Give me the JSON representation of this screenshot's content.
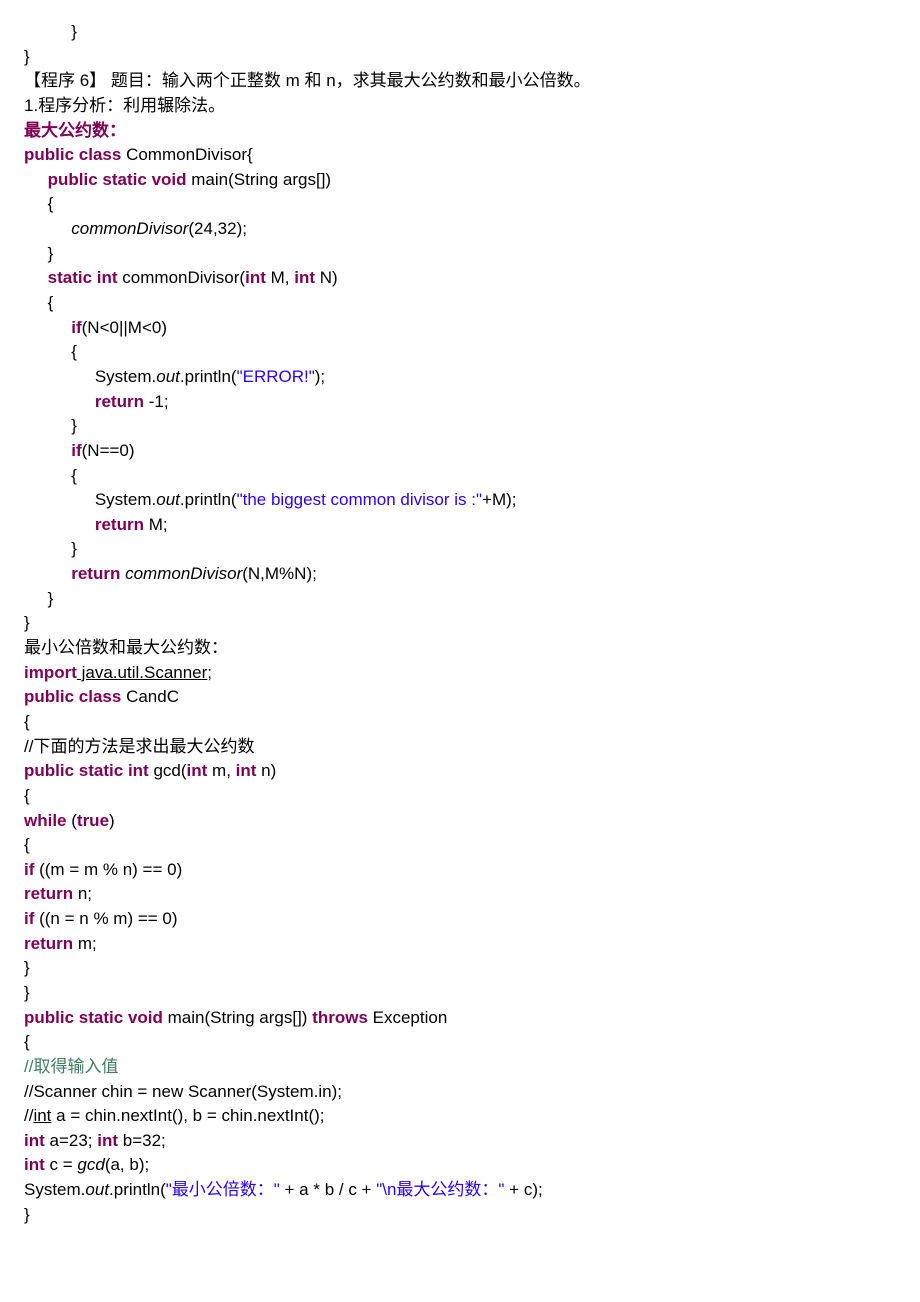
{
  "closing1": "          }",
  "closing2": "}",
  "progTitle": "【程序 6】  题目：输入两个正整数 m 和 n，求其最大公约数和最小公倍数。",
  "analysis": "1.程序分析：利用辗除法。",
  "header1": "最大公约数：",
  "code1": {
    "t": {
      "public": "public",
      "class": "class",
      "static": "static",
      "void": "void",
      "int": "int",
      "if": "if",
      "return": "return",
      "classname": " CommonDivisor{",
      "main": " main(String args[])",
      "lbrace": "     {",
      "call": "(24,32);",
      "callname": "commonDivisor",
      "rbrace": "     }",
      "sig1": " commonDivisor(",
      "sigM": " M, ",
      "sigN": " N)",
      "cond1": "(N<0||M<0)",
      "lbr2": "          {",
      "sys": "               System.",
      "out": "out",
      "println": ".println(",
      "str1": "\"ERROR!\"",
      "str2": "\"the biggest common divisor is :\"",
      "plusM": "+M);",
      "neg1": " -1;",
      "retM": " M;",
      "cond2": "(N==0)",
      "rbr2": "          }",
      "ret3a": "          ",
      "ret3b": " ",
      "ret3c": "commonDivisor",
      "ret3d": "(N,M%N);",
      "close": "}",
      "ind15": "               ",
      "ind10": "          "
    }
  },
  "header2": "最小公倍数和最大公约数：",
  "code2": {
    "t": {
      "import": "import",
      "public": "public",
      "class": "class",
      "static": "static",
      "int": "int",
      "while": "while",
      "true": "true",
      "if": "if",
      "return": "return",
      "void": "void",
      "throws": "throws",
      "scanner": " java.util.Scanner",
      "classname": " CandC",
      "lbr": "{",
      "rbr": "}",
      "cmt1": "//下面的方法是求出最大公约数",
      "gcdSig1": " gcd(",
      "gcdSigM": " m, ",
      "gcdSigN": " n)",
      "cond1": " ((m = m % n) == 0)",
      "retn": " n;",
      "cond2": " ((n = n % m) == 0)",
      "retm": " m;",
      "mainSig": " main(String args[]) ",
      "exc": " Exception",
      "cmt2": "//取得输入值",
      "cmt3": "//Scanner chin = new Scanner(System.in);",
      "cmt4a": "//",
      "cmt4b": "int",
      "cmt4c": " a = chin.nextInt(), b = chin.nextInt();",
      "a23": " a=23; ",
      "b32": " b=32;",
      "cline1": " c = ",
      "gcd": "gcd",
      "cline2": "(a, b);",
      "sys": "System.",
      "out": "out",
      "println": ".println(",
      "s1": "\"最小公倍数：\"",
      "mid": " + a * b / c + ",
      "s2": "\"\\n最大公约数：\"",
      "end": " + c);",
      "semi": ";",
      "sp": " ",
      "lparen": " (",
      "rparen": ")"
    }
  }
}
